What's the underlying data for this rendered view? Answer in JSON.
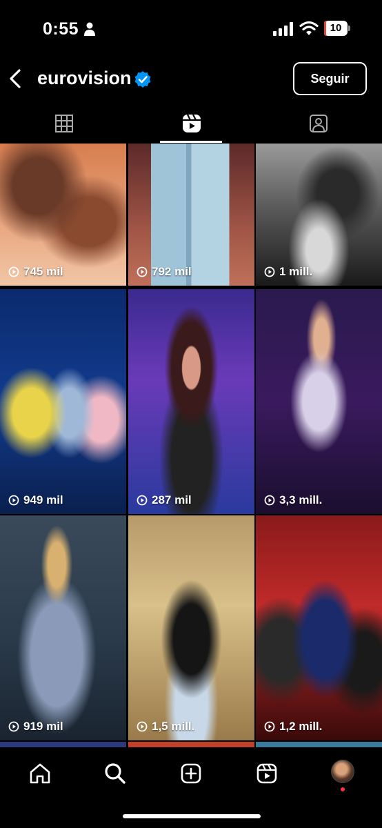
{
  "status_bar": {
    "time": "0:55",
    "battery": "10",
    "battery_level": 0.1
  },
  "header": {
    "profile_name": "eurovision",
    "follow_label": "Seguir"
  },
  "tabs": [
    {
      "icon": "grid-icon",
      "active": false
    },
    {
      "icon": "reels-icon",
      "active": true
    },
    {
      "icon": "tagged-icon",
      "active": false
    }
  ],
  "reels": [
    {
      "views": "745 mil"
    },
    {
      "views": "792 mil"
    },
    {
      "views": "1 mill."
    },
    {
      "views": "949 mil"
    },
    {
      "views": "287 mil"
    },
    {
      "views": "3,3 mill."
    },
    {
      "views": "919 mil"
    },
    {
      "views": "1,5 mill."
    },
    {
      "views": "1,2 mill."
    }
  ],
  "bottom_nav": [
    {
      "icon": "home-icon"
    },
    {
      "icon": "search-icon"
    },
    {
      "icon": "create-icon"
    },
    {
      "icon": "reels-icon"
    },
    {
      "icon": "profile-avatar"
    }
  ],
  "colors": {
    "background": "#000000",
    "verified": "#0095f6",
    "notification": "#ff3040"
  }
}
